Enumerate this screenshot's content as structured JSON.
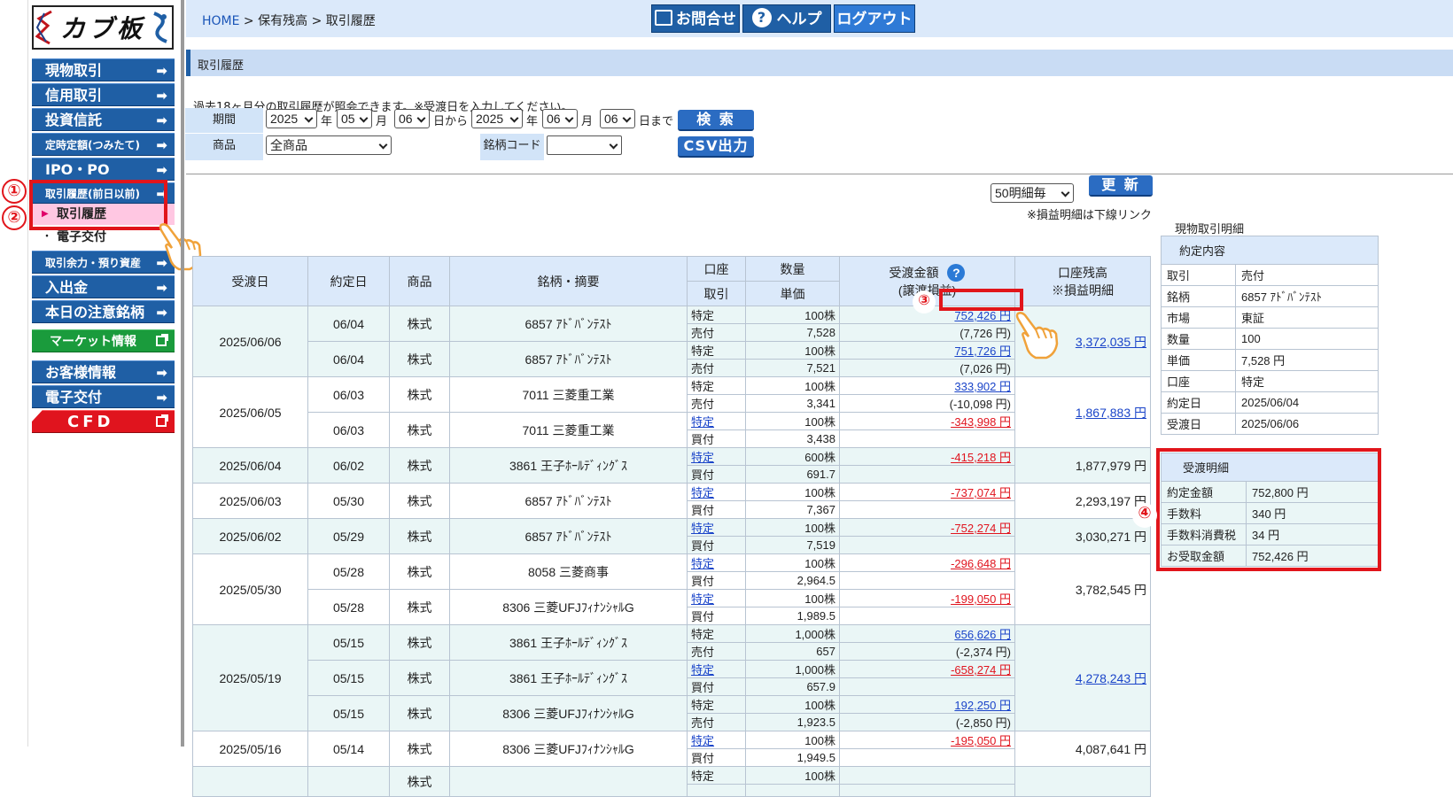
{
  "sidebar": {
    "logo_text": "カブ板",
    "items": [
      {
        "label": "現物取引",
        "arrow": "➡"
      },
      {
        "label": "信用取引",
        "arrow": "➡"
      },
      {
        "label": "投資信託",
        "arrow": "➡"
      },
      {
        "label": "定時定額(つみたて)",
        "arrow": "➡"
      },
      {
        "label": "IPO・PO",
        "arrow": "➡"
      },
      {
        "label": "取引履歴(前日以前)",
        "arrow": "➡"
      },
      {
        "label": "取引履歴"
      },
      {
        "label": "電子交付"
      },
      {
        "label": "取引余力・預り資産",
        "arrow": "➡"
      },
      {
        "label": "入出金",
        "arrow": "➡"
      },
      {
        "label": "本日の注意銘柄",
        "arrow": "➡"
      },
      {
        "label": "マーケット情報"
      },
      {
        "label": "お客様情報",
        "arrow": "➡"
      },
      {
        "label": "電子交付",
        "arrow": "➡"
      },
      {
        "label": "CFD"
      }
    ]
  },
  "annotations": {
    "n1": "①",
    "n2": "②",
    "n3": "③",
    "n4": "④"
  },
  "header": {
    "breadcrumb": {
      "home": "HOME",
      "sep1": " > ",
      "p1": "保有残高",
      "sep2": " > ",
      "p2": "取引履歴"
    },
    "contact": "お問合せ",
    "help": "ヘルプ",
    "logout": "ログアウト"
  },
  "section_title": "取引履歴",
  "search": {
    "note": "過去18ヶ月分の取引履歴が照会できます。※受渡日を入力してください。",
    "period_label": "期間",
    "from_year": "2025",
    "year1": "年",
    "from_month": "05",
    "month1": "月",
    "from_day": "06",
    "from_suffix": "日から",
    "to_year": "2025",
    "year2": "年",
    "to_month": "06",
    "month2": "月",
    "to_day": "06",
    "to_suffix": "日まで",
    "search_button": "検 索",
    "product_label": "商品",
    "product_value": "全商品",
    "code_label": "銘柄コード",
    "code_value": "",
    "csv_button": "CSV出力"
  },
  "list": {
    "per_page": "50明細毎",
    "refresh": "更 新",
    "note": "※損益明細は下線リンク"
  },
  "table": {
    "headers": {
      "settle_date": "受渡日",
      "trade_date": "約定日",
      "product": "商品",
      "issue": "銘柄・摘要",
      "account": "口座",
      "trade": "取引",
      "qty": "数量",
      "price": "単価",
      "amount": "受渡金額",
      "pl": "(譲渡損益)",
      "balance": "口座残高",
      "balance_note": "※損益明細"
    },
    "help_icon": "?",
    "rows": [
      {
        "settle": "2025/06/06",
        "trade": "06/04",
        "product": "株式",
        "issue": "6857 ｱﾄﾞﾊﾞﾝﾃｽﾄ",
        "account": "特定",
        "side": "売付",
        "qty": "100株",
        "price": "7,528",
        "amount": "752,426 円",
        "pl": "(7,726 円)",
        "balance": "3,372,035 円"
      },
      {
        "settle": "",
        "trade": "06/04",
        "product": "株式",
        "issue": "6857 ｱﾄﾞﾊﾞﾝﾃｽﾄ",
        "account": "特定",
        "side": "売付",
        "qty": "100株",
        "price": "7,521",
        "amount": "751,726 円",
        "pl": "(7,026 円)",
        "balance": ""
      },
      {
        "settle": "2025/06/05",
        "trade": "06/03",
        "product": "株式",
        "issue": "7011 三菱重工業",
        "account": "特定",
        "side": "売付",
        "qty": "100株",
        "price": "3,341",
        "amount": "333,902 円",
        "pl": "(-10,098 円)",
        "balance": "1,867,883 円"
      },
      {
        "settle": "",
        "trade": "06/03",
        "product": "株式",
        "issue": "7011 三菱重工業",
        "account": "特定",
        "side": "買付",
        "qty": "100株",
        "price": "3,438",
        "amount": "-343,998 円",
        "pl": "",
        "balance": ""
      },
      {
        "settle": "2025/06/04",
        "trade": "06/02",
        "product": "株式",
        "issue": "3861 王子ﾎｰﾙﾃﾞｨﾝｸﾞｽ",
        "account": "特定",
        "side": "買付",
        "qty": "600株",
        "price": "691.7",
        "amount": "-415,218 円",
        "pl": "",
        "balance": "1,877,979 円"
      },
      {
        "settle": "2025/06/03",
        "trade": "05/30",
        "product": "株式",
        "issue": "6857 ｱﾄﾞﾊﾞﾝﾃｽﾄ",
        "account": "特定",
        "side": "買付",
        "qty": "100株",
        "price": "7,367",
        "amount": "-737,074 円",
        "pl": "",
        "balance": "2,293,197 円"
      },
      {
        "settle": "2025/06/02",
        "trade": "05/29",
        "product": "株式",
        "issue": "6857 ｱﾄﾞﾊﾞﾝﾃｽﾄ",
        "account": "特定",
        "side": "買付",
        "qty": "100株",
        "price": "7,519",
        "amount": "-752,274 円",
        "pl": "",
        "balance": "3,030,271 円"
      },
      {
        "settle": "2025/05/30",
        "trade": "05/28",
        "product": "株式",
        "issue": "8058 三菱商事",
        "account": "特定",
        "side": "買付",
        "qty": "100株",
        "price": "2,964.5",
        "amount": "-296,648 円",
        "pl": "",
        "balance": "3,782,545 円"
      },
      {
        "settle": "",
        "trade": "05/28",
        "product": "株式",
        "issue": "8306 三菱UFJﾌｨﾅﾝｼｬﾙG",
        "account": "特定",
        "side": "買付",
        "qty": "100株",
        "price": "1,989.5",
        "amount": "-199,050 円",
        "pl": "",
        "balance": ""
      },
      {
        "settle": "2025/05/19",
        "trade": "05/15",
        "product": "株式",
        "issue": "3861 王子ﾎｰﾙﾃﾞｨﾝｸﾞｽ",
        "account": "特定",
        "side": "売付",
        "qty": "1,000株",
        "price": "657",
        "amount": "656,626 円",
        "pl": "(-2,374 円)",
        "balance": "4,278,243 円"
      },
      {
        "settle": "",
        "trade": "05/15",
        "product": "株式",
        "issue": "3861 王子ﾎｰﾙﾃﾞｨﾝｸﾞｽ",
        "account": "特定",
        "side": "買付",
        "qty": "1,000株",
        "price": "657.9",
        "amount": "-658,274 円",
        "pl": "",
        "balance": ""
      },
      {
        "settle": "",
        "trade": "05/15",
        "product": "株式",
        "issue": "8306 三菱UFJﾌｨﾅﾝｼｬﾙG",
        "account": "特定",
        "side": "売付",
        "qty": "100株",
        "price": "1,923.5",
        "amount": "192,250 円",
        "pl": "(-2,850 円)",
        "balance": ""
      },
      {
        "settle": "2025/05/16",
        "trade": "05/14",
        "product": "株式",
        "issue": "8306 三菱UFJﾌｨﾅﾝｼｬﾙG",
        "account": "特定",
        "side": "買付",
        "qty": "100株",
        "price": "1,949.5",
        "amount": "-195,050 円",
        "pl": "",
        "balance": "4,087,641 円"
      },
      {
        "settle": "",
        "trade": "",
        "product": "株式",
        "issue": "",
        "account": "特定",
        "side": "",
        "qty": "100株",
        "price": "",
        "amount": "",
        "pl": "",
        "balance": ""
      }
    ]
  },
  "detail": {
    "title": "現物取引明細",
    "contract_header": "約定内容",
    "contract": [
      {
        "k": "取引",
        "v": "売付"
      },
      {
        "k": "銘柄",
        "v": "6857 ｱﾄﾞﾊﾞﾝﾃｽﾄ"
      },
      {
        "k": "市場",
        "v": "東証"
      },
      {
        "k": "数量",
        "v": "100"
      },
      {
        "k": "単価",
        "v": "7,528 円"
      },
      {
        "k": "口座",
        "v": "特定"
      },
      {
        "k": "約定日",
        "v": "2025/06/04"
      },
      {
        "k": "受渡日",
        "v": "2025/06/06"
      }
    ],
    "settle_header": "受渡明細",
    "settle": [
      {
        "k": "約定金額",
        "v": "752,800 円"
      },
      {
        "k": "手数料",
        "v": "340 円"
      },
      {
        "k": "手数料消費税",
        "v": "34 円"
      },
      {
        "k": "お受取金額",
        "v": "752,426 円"
      }
    ]
  },
  "colors": {
    "nav_blue": "#1f5fa5",
    "green": "#1a9b3c",
    "cfd_red": "#e0141e",
    "highlight_red": "#e1151b",
    "active_pink": "#ffc7e2",
    "link_blue": "#1a44c9",
    "neg_red": "#e0141e"
  }
}
